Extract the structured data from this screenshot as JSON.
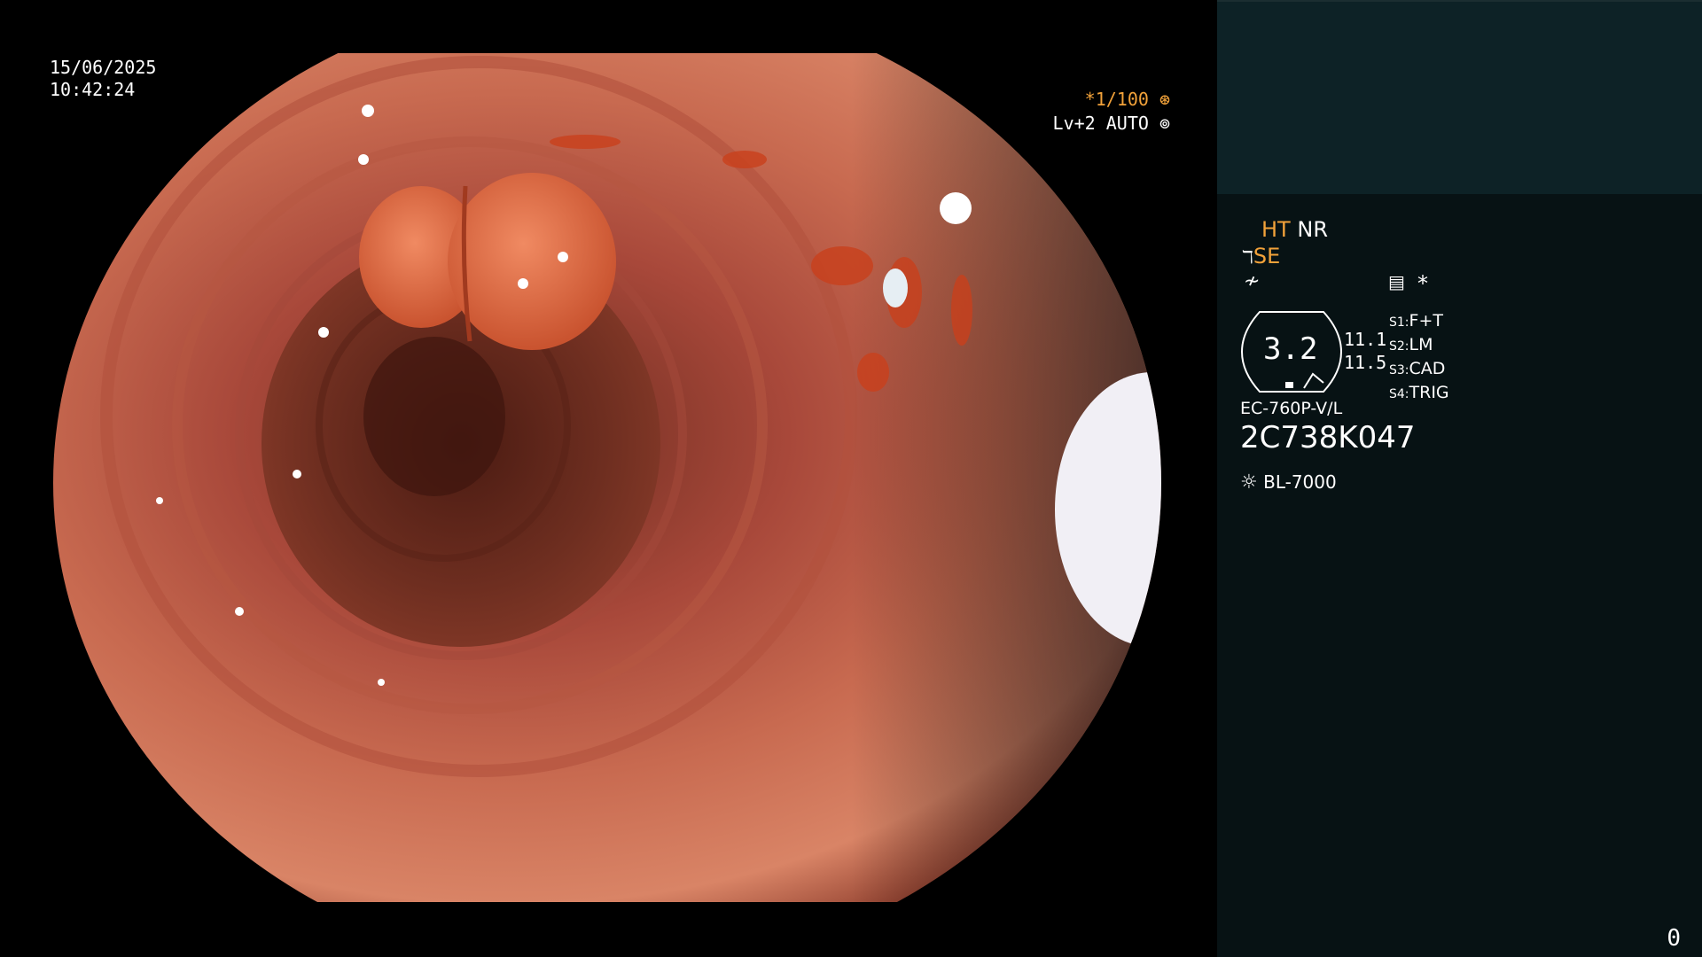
{
  "image_view": {
    "date": "15/06/2025",
    "time": "10:42:24",
    "shutter": "*1/100",
    "shutter_icon": "aperture-icon",
    "level": "Lv+2 AUTO",
    "level_icon": "auto-iris-icon"
  },
  "panel": {
    "ht_label": "HT",
    "nr_label": "NR",
    "se_label": "SE",
    "se_icon": "structure-enhance-icon",
    "freeze_icon": "freeze-off-icon",
    "memo_icon": "memo-icon",
    "asterisk": "*",
    "scope_value": "3.2",
    "values": [
      "11.1",
      "11.5"
    ],
    "switches": [
      {
        "key": "S1:",
        "value": "F+T"
      },
      {
        "key": "S2:",
        "value": "LM"
      },
      {
        "key": "S3:",
        "value": "CAD"
      },
      {
        "key": "S4:",
        "value": "TRIG"
      }
    ],
    "scope_model": "EC-760P-V/L",
    "serial": "2C738K047",
    "light_source": "BL-7000",
    "light_icon": "lamp-icon",
    "counter": "0"
  },
  "colors": {
    "amber": "#f2a23a",
    "panel_bg": "#071214",
    "panel_top_bg": "#0d2226",
    "mucosa": "#c7664a"
  }
}
